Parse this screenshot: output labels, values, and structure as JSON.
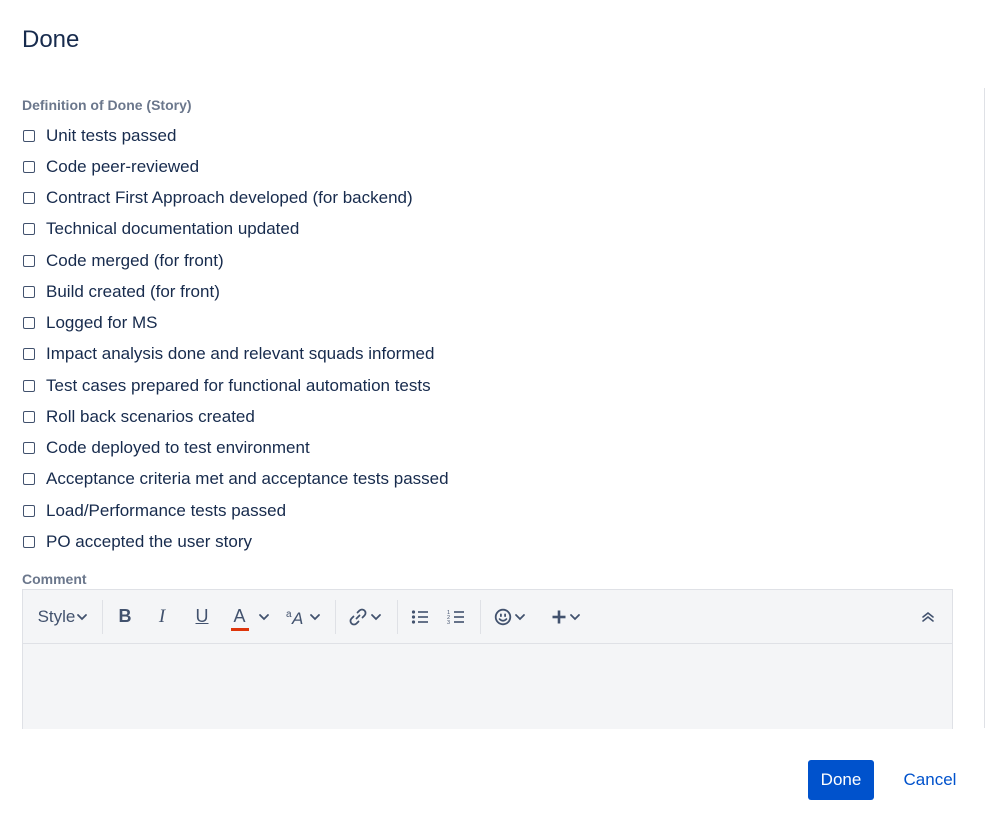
{
  "dialog": {
    "title": "Done"
  },
  "definition_of_done": {
    "label": "Definition of Done (Story)",
    "items": [
      {
        "label": "Unit tests passed",
        "checked": false
      },
      {
        "label": "Code peer-reviewed",
        "checked": false
      },
      {
        "label": "Contract First Approach developed (for backend)",
        "checked": false
      },
      {
        "label": "Technical documentation updated",
        "checked": false
      },
      {
        "label": "Code merged (for front)",
        "checked": false
      },
      {
        "label": "Build created (for front)",
        "checked": false
      },
      {
        "label": "Logged for MS",
        "checked": false
      },
      {
        "label": "Impact analysis done and relevant squads informed",
        "checked": false
      },
      {
        "label": "Test cases prepared for functional automation tests",
        "checked": false
      },
      {
        "label": "Roll back scenarios created",
        "checked": false
      },
      {
        "label": "Code deployed to test environment",
        "checked": false
      },
      {
        "label": "Acceptance criteria met and acceptance tests passed",
        "checked": false
      },
      {
        "label": "Load/Performance tests passed",
        "checked": false
      },
      {
        "label": "PO accepted the user story",
        "checked": false
      }
    ]
  },
  "comment": {
    "label": "Comment",
    "value": "",
    "toolbar": {
      "style_label": "Style",
      "bold": "B",
      "italic": "I",
      "underline": "U",
      "text_color": "A",
      "text_color_accent": "#de350b"
    }
  },
  "footer": {
    "done_label": "Done",
    "cancel_label": "Cancel"
  },
  "colors": {
    "primary": "#0052cc",
    "text": "#172b4d",
    "muted": "#6b778c",
    "editor_bg": "#f4f5f7"
  }
}
